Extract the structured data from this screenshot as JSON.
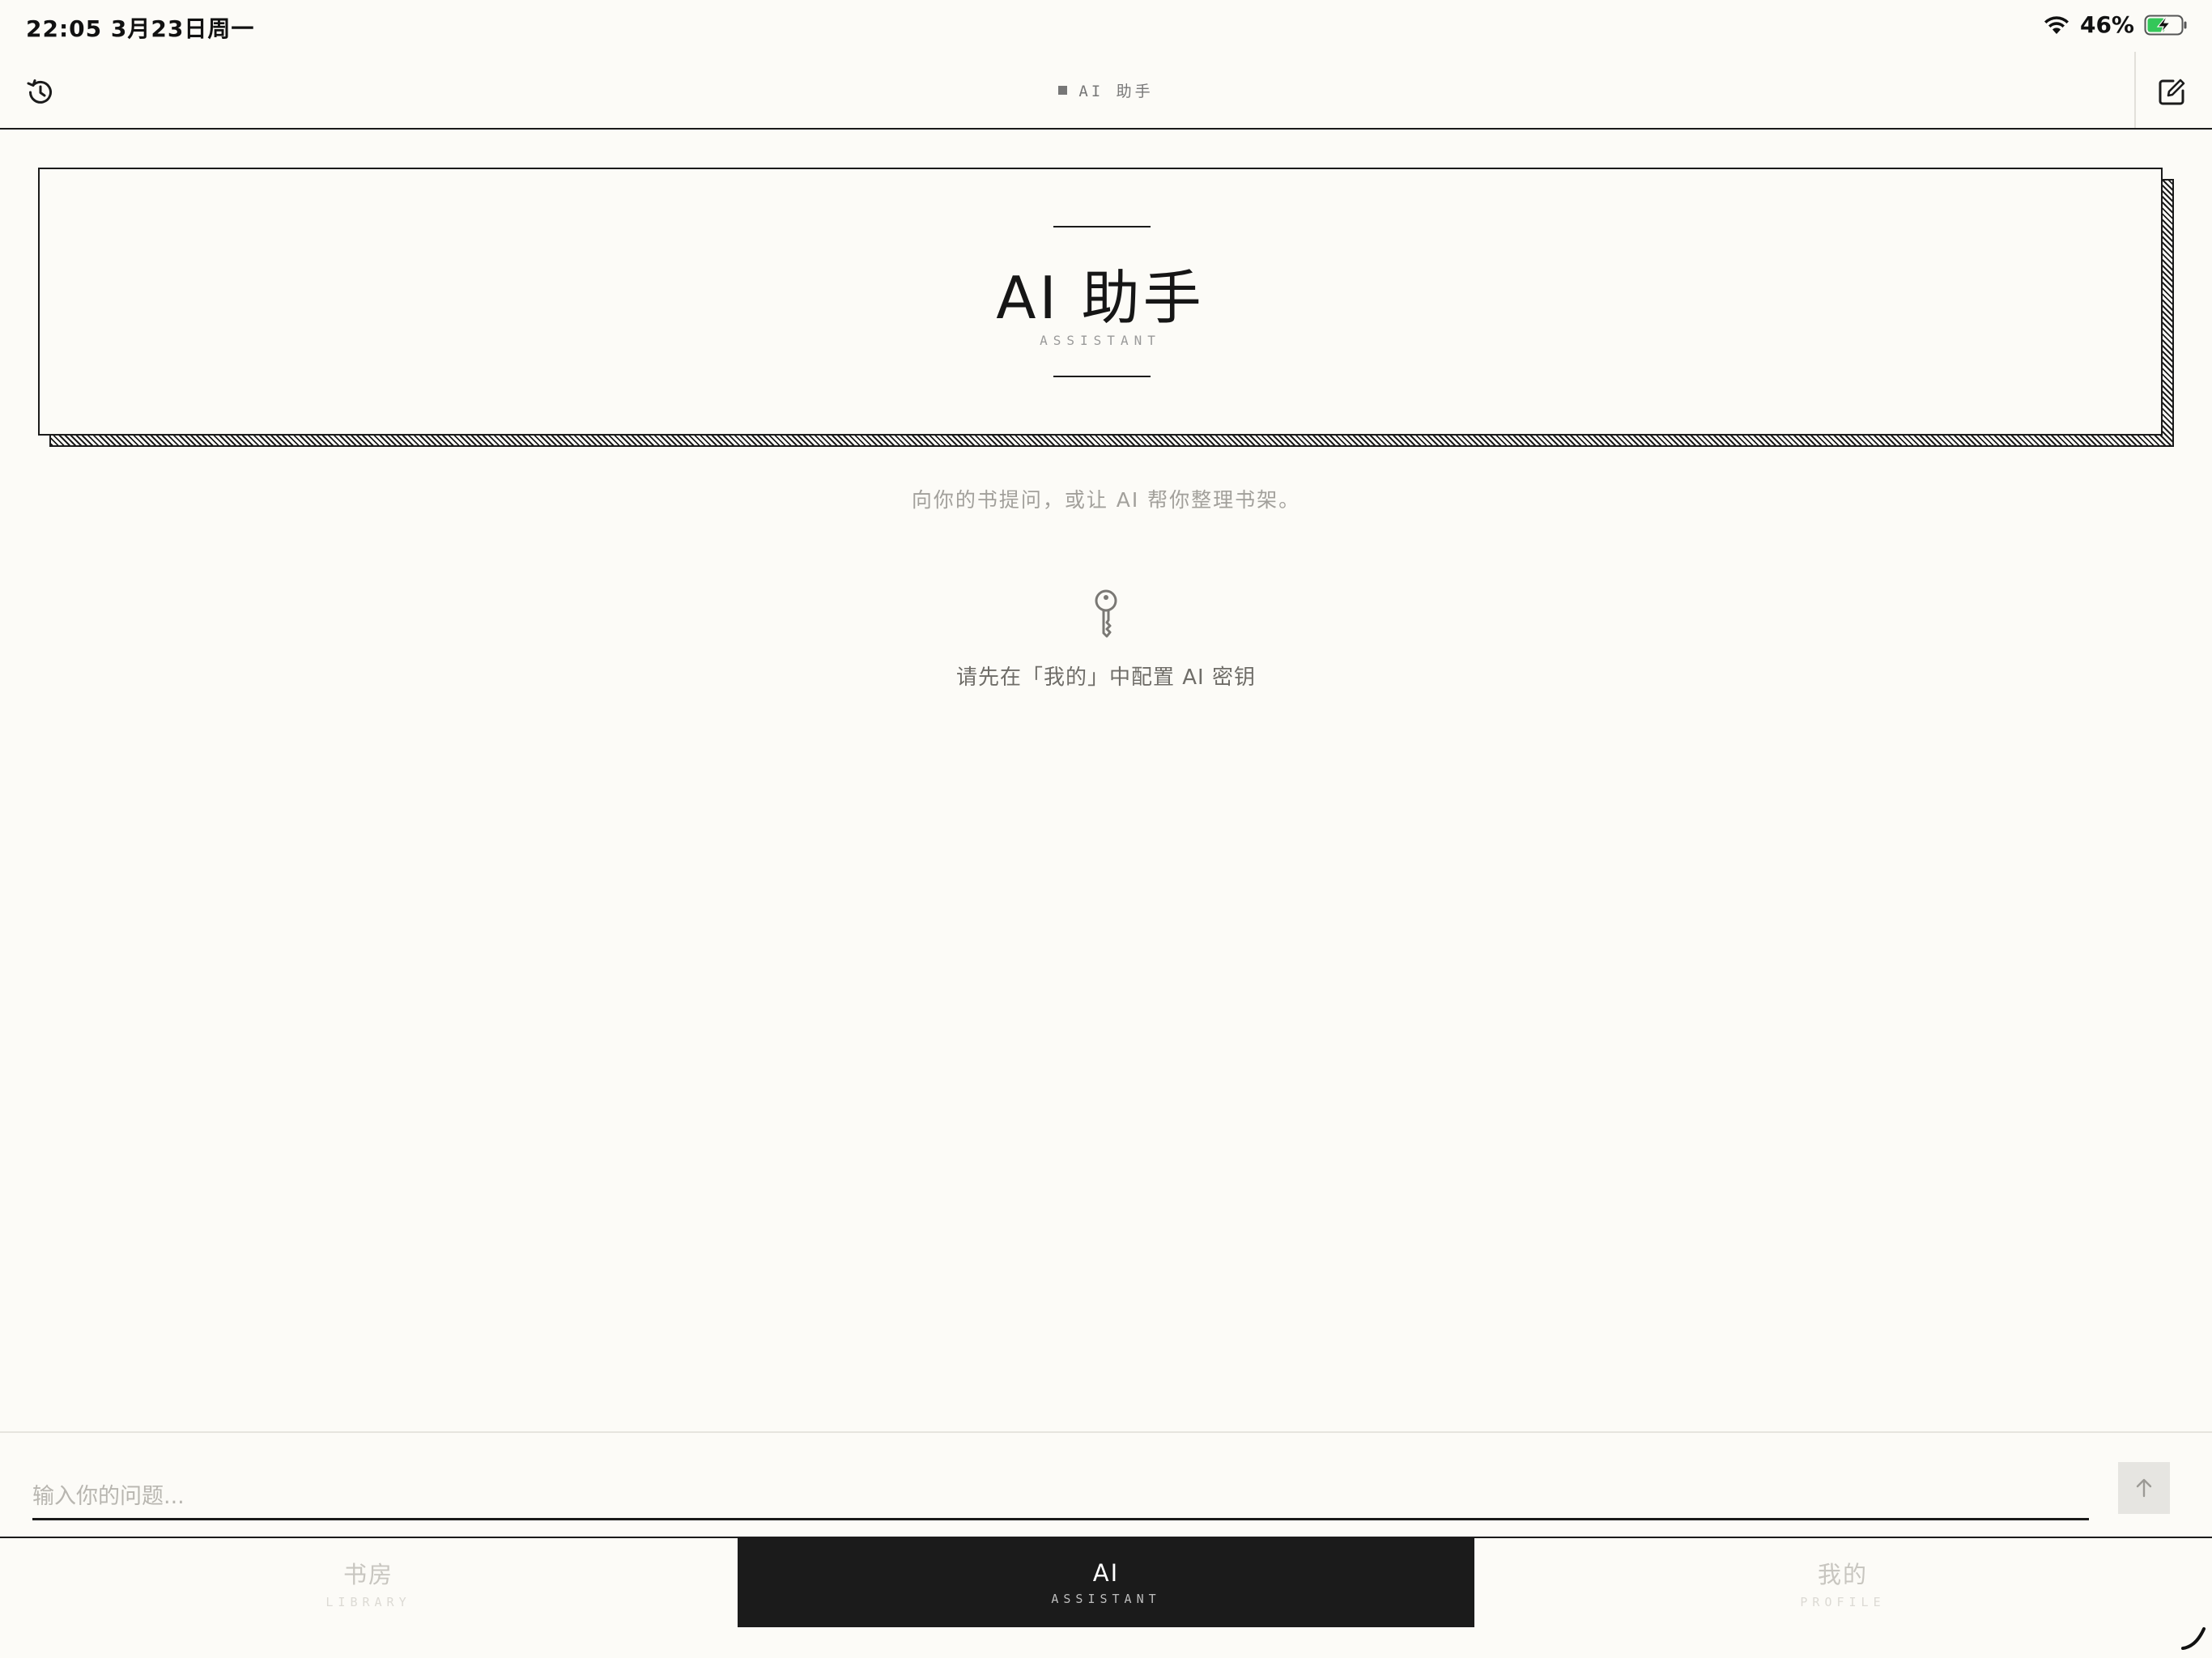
{
  "status": {
    "time": "22:05  3月23日周一",
    "battery_percent": "46%"
  },
  "nav": {
    "title": "AI 助手",
    "left_icon": "history-icon",
    "right_icon": "compose-icon"
  },
  "header": {
    "title": "AI 助手",
    "subtitle": "ASSISTANT"
  },
  "intro": "向你的书提问，或让 AI 帮你整理书架。",
  "notice": {
    "icon": "key-icon",
    "text": "请先在「我的」中配置 AI 密钥"
  },
  "input": {
    "placeholder": "输入你的问题...",
    "value": "",
    "send_icon": "arrow-up-icon"
  },
  "tabs": [
    {
      "label": "书房",
      "sub": "LIBRARY",
      "active": false
    },
    {
      "label": "AI",
      "sub": "ASSISTANT",
      "active": true
    },
    {
      "label": "我的",
      "sub": "PROFILE",
      "active": false
    }
  ],
  "colors": {
    "background": "#fcfbf7",
    "ink": "#1b1b1b",
    "muted": "#a2a09b",
    "battery_charging": "#34c759"
  }
}
